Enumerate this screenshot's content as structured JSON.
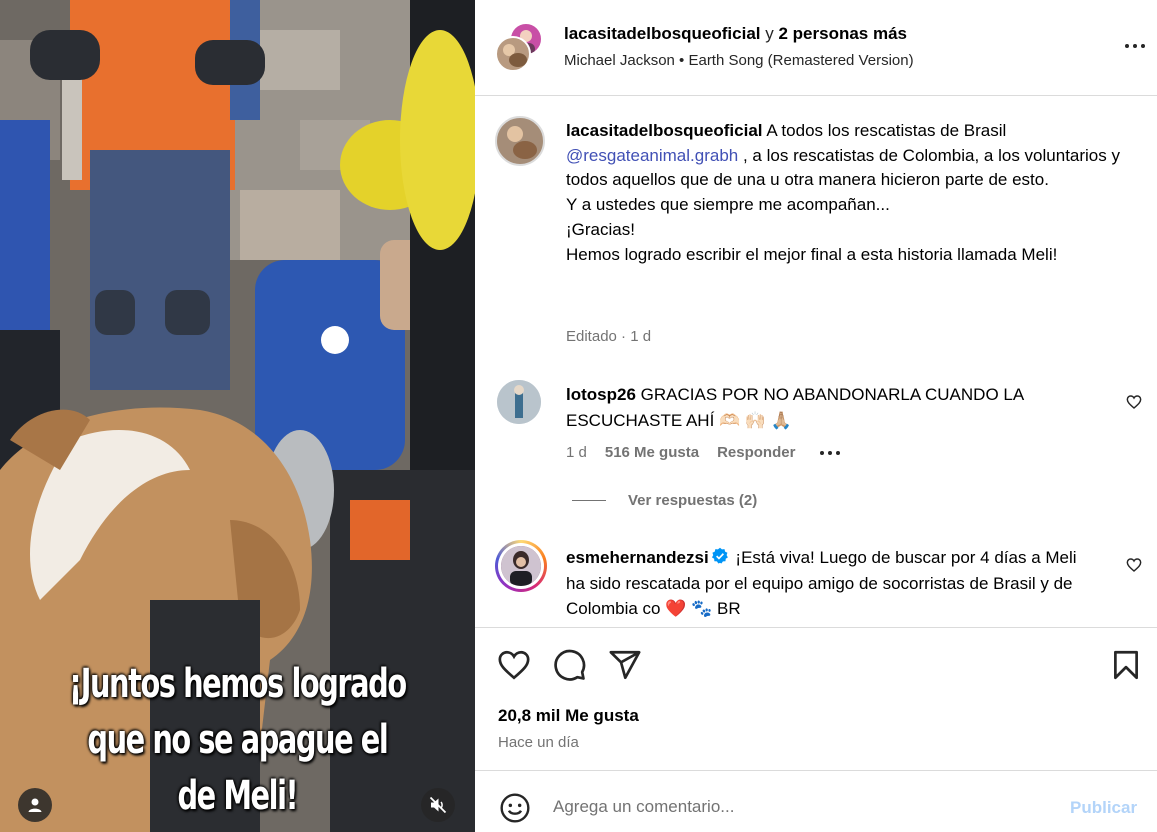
{
  "media": {
    "caption_line1": "¡Juntos hemos logrado",
    "caption_line2": "que no se apague el de Meli!",
    "user_icon": "user-icon",
    "mute_icon": "speaker-muted-icon"
  },
  "header": {
    "username": "lacasitadelbosqueoficial",
    "connector": "y",
    "others": "2 personas más",
    "audio": "Michael Jackson • Earth Song (Remastered Version)",
    "more_icon": "more-horizontal-icon"
  },
  "post_caption": {
    "username": "lacasitadelbosqueoficial",
    "text_1": "A todos los rescatistas de Brasil",
    "mention": "@resgateanimal.grabh",
    "text_2": ", a los rescatistas de Colombia, a los voluntarios y todos aquellos que de una u otra manera hicieron parte de esto.",
    "line_3": "Y a ustedes que siempre me acompañan...",
    "line_4": "¡Gracias!",
    "line_5": "Hemos logrado escribir el mejor final a esta historia llamada Meli!",
    "meta": "Editado · 1 d"
  },
  "comments": [
    {
      "username": "lotosp26",
      "text": "GRACIAS POR NO ABANDONARLA CUANDO LA ESCUCHASTE AHÍ",
      "emojis": "🫶🏻 🙌🏻 🙏🏼",
      "time": "1 d",
      "likes": "516 Me gusta",
      "reply": "Responder",
      "replies_label": "Ver respuestas (2)"
    },
    {
      "username": "esmehernandezsi",
      "text": "¡Está viva! Luego de buscar por 4 días a Meli ha sido rescatada por el equipo amigo de socorristas de Brasil y de Colombia co",
      "emojis": "❤️ 🐾 BR"
    }
  ],
  "actions": {
    "likes": "20,8 mil Me gusta",
    "time_ago": "Hace un día"
  },
  "comment_box": {
    "placeholder": "Agrega un comentario...",
    "publish": "Publicar"
  },
  "colors": {
    "link": "#4150b5",
    "muted": "#737373",
    "publish_disabled": "#b3d4f9",
    "border": "#dbdbdb"
  }
}
